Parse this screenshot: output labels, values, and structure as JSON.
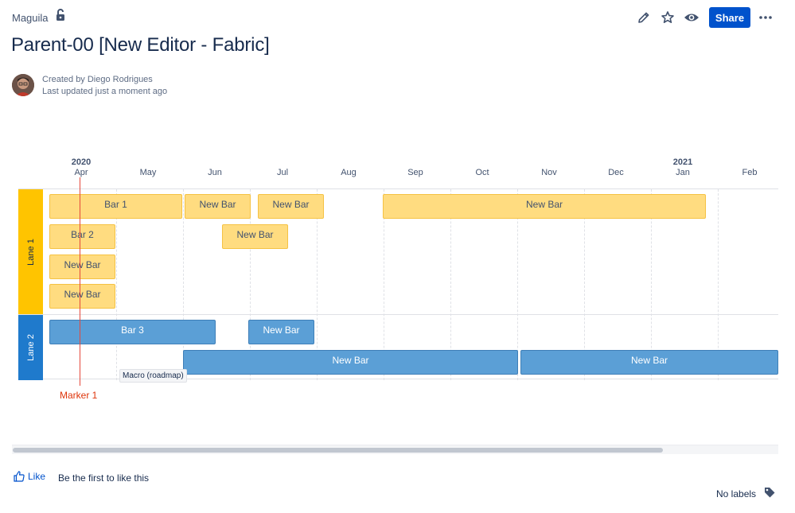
{
  "header": {
    "space_name": "Maguila",
    "share_label": "Share"
  },
  "page": {
    "title": "Parent-00 [New Editor - Fabric]",
    "created_by": "Created by Diego Rodrigues",
    "last_updated": "Last updated just a moment ago"
  },
  "roadmap": {
    "years": [
      {
        "label": "2020"
      },
      {
        "label": "2021"
      }
    ],
    "months": [
      "Apr",
      "May",
      "Jun",
      "Jul",
      "Aug",
      "Sep",
      "Oct",
      "Nov",
      "Dec",
      "Jan",
      "Feb"
    ],
    "lanes": [
      {
        "name": "Lane 1",
        "color": "#FFC400"
      },
      {
        "name": "Lane 2",
        "color": "#1F7ACC"
      }
    ],
    "bars": [
      {
        "title": "Bar 1",
        "lane": "Lane 1",
        "color": "#FFDC80"
      },
      {
        "title": "New Bar",
        "lane": "Lane 1",
        "color": "#FFDC80"
      },
      {
        "title": "New Bar",
        "lane": "Lane 1",
        "color": "#FFDC80"
      },
      {
        "title": "New Bar",
        "lane": "Lane 1",
        "color": "#FFDC80"
      },
      {
        "title": "Bar 2",
        "lane": "Lane 1",
        "color": "#FFDC80"
      },
      {
        "title": "New Bar",
        "lane": "Lane 1",
        "color": "#FFDC80"
      },
      {
        "title": "New Bar",
        "lane": "Lane 1",
        "color": "#FFDC80"
      },
      {
        "title": "New Bar",
        "lane": "Lane 1",
        "color": "#FFDC80"
      },
      {
        "title": "Bar 3",
        "lane": "Lane 2",
        "color": "#5B9FD6"
      },
      {
        "title": "New Bar",
        "lane": "Lane 2",
        "color": "#5B9FD6"
      },
      {
        "title": "New Bar",
        "lane": "Lane 2",
        "color": "#5B9FD6"
      },
      {
        "title": "New Bar",
        "lane": "Lane 2",
        "color": "#5B9FD6"
      }
    ],
    "marker": {
      "label": "Marker 1",
      "color": "#DE350B"
    },
    "macro_tooltip": "Macro (roadmap)"
  },
  "footer": {
    "like_label": "Like",
    "like_text": "Be the first to like this",
    "labels_text": "No labels"
  },
  "icons": {
    "lock": "lock-icon",
    "edit": "pencil-icon",
    "star": "star-icon",
    "watch": "eye-icon",
    "more": "more-icon",
    "like": "thumbs-up-icon",
    "labels": "tag-icon"
  },
  "colors": {
    "accent": "#0052CC"
  }
}
